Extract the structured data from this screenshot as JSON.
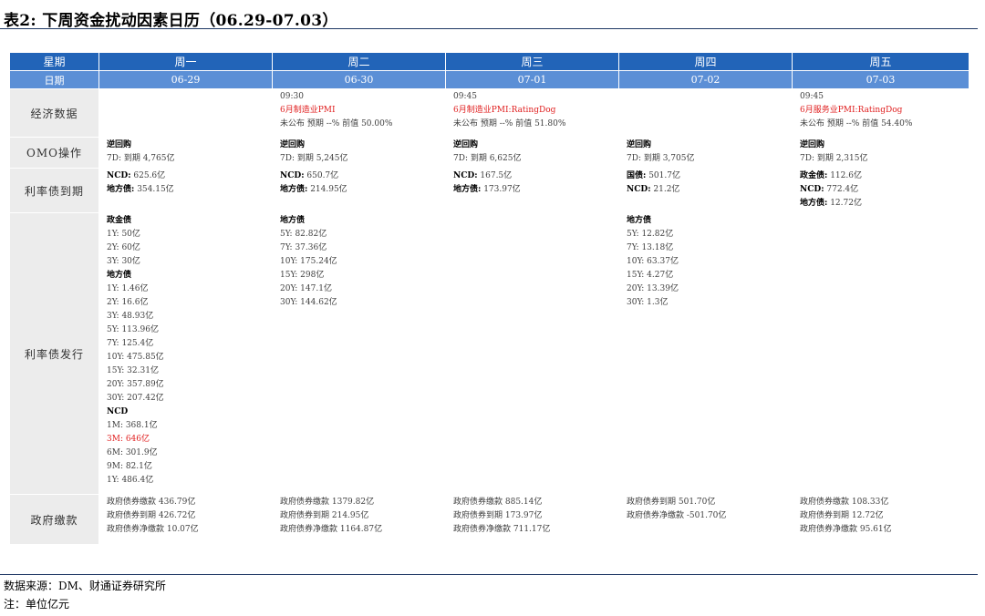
{
  "title": "表2: 下周资金扰动因素日历（06.29-07.03）",
  "header": {
    "corner_day": "星期",
    "corner_date": "日期",
    "days": [
      {
        "day": "周一",
        "date": "06-29"
      },
      {
        "day": "周二",
        "date": "06-30"
      },
      {
        "day": "周三",
        "date": "07-01"
      },
      {
        "day": "周四",
        "date": "07-02"
      },
      {
        "day": "周五",
        "date": "07-03"
      }
    ]
  },
  "rows": {
    "econ": {
      "label": "经济数据",
      "cells": [
        [],
        [
          {
            "t": "09:30"
          },
          {
            "t": "6月制造业PMI",
            "red": true
          },
          {
            "t": "未公布 预期 --% 前值 50.00%"
          }
        ],
        [
          {
            "t": "09:45"
          },
          {
            "t": "6月制造业PMI:RatingDog",
            "red": true
          },
          {
            "t": "未公布 预期 --% 前值 51.80%"
          }
        ],
        [],
        [
          {
            "t": "09:45"
          },
          {
            "t": "6月服务业PMI:RatingDog",
            "red": true
          },
          {
            "t": "未公布 预期 --% 前值 54.40%"
          }
        ]
      ]
    },
    "omo": {
      "label": "OMO操作",
      "cells": [
        [
          {
            "k": "逆回购",
            "v": ""
          },
          {
            "t": "7D: 到期 4,765亿"
          }
        ],
        [
          {
            "k": "逆回购",
            "v": ""
          },
          {
            "t": "7D: 到期 5,245亿"
          }
        ],
        [
          {
            "k": "逆回购",
            "v": ""
          },
          {
            "t": "7D: 到期 6,625亿"
          }
        ],
        [
          {
            "k": "逆回购",
            "v": ""
          },
          {
            "t": "7D: 到期 3,705亿"
          }
        ],
        [
          {
            "k": "逆回购",
            "v": ""
          },
          {
            "t": "7D: 到期 2,315亿"
          }
        ]
      ]
    },
    "mature": {
      "label": "利率债到期",
      "cells": [
        [
          {
            "k": "NCD:",
            "v": " 625.6亿"
          },
          {
            "k": "地方债:",
            "v": " 354.15亿"
          }
        ],
        [
          {
            "k": "NCD:",
            "v": " 650.7亿"
          },
          {
            "k": "地方债:",
            "v": " 214.95亿"
          }
        ],
        [
          {
            "k": "NCD:",
            "v": " 167.5亿"
          },
          {
            "k": "地方债:",
            "v": " 173.97亿"
          }
        ],
        [
          {
            "k": "国债:",
            "v": " 501.7亿"
          },
          {
            "k": "NCD:",
            "v": " 21.2亿"
          }
        ],
        [
          {
            "k": "政金债:",
            "v": " 112.6亿"
          },
          {
            "k": "NCD:",
            "v": " 772.4亿"
          },
          {
            "k": "地方债:",
            "v": " 12.72亿"
          }
        ]
      ]
    },
    "issue": {
      "label": "利率债发行",
      "cells": [
        [
          {
            "k": "政金债",
            "v": ""
          },
          {
            "t": "1Y: 50亿"
          },
          {
            "t": "2Y: 60亿"
          },
          {
            "t": "3Y: 30亿"
          },
          {
            "k": "地方债",
            "v": ""
          },
          {
            "t": "1Y: 1.46亿"
          },
          {
            "t": "2Y: 16.6亿"
          },
          {
            "t": "3Y: 48.93亿"
          },
          {
            "t": "5Y: 113.96亿"
          },
          {
            "t": "7Y: 125.4亿"
          },
          {
            "t": "10Y: 475.85亿"
          },
          {
            "t": "15Y: 32.31亿"
          },
          {
            "t": "20Y: 357.89亿"
          },
          {
            "t": "30Y: 207.42亿"
          },
          {
            "k": "NCD",
            "v": ""
          },
          {
            "t": "1M: 368.1亿"
          },
          {
            "t": "3M: 646亿",
            "red": true
          },
          {
            "t": "6M: 301.9亿"
          },
          {
            "t": "9M: 82.1亿"
          },
          {
            "t": "1Y: 486.4亿"
          }
        ],
        [
          {
            "k": "地方债",
            "v": ""
          },
          {
            "t": "5Y: 82.82亿"
          },
          {
            "t": "7Y: 37.36亿"
          },
          {
            "t": "10Y: 175.24亿"
          },
          {
            "t": "15Y: 298亿"
          },
          {
            "t": "20Y: 147.1亿"
          },
          {
            "t": "30Y: 144.62亿"
          }
        ],
        [],
        [
          {
            "k": "地方债",
            "v": ""
          },
          {
            "t": "5Y: 12.82亿"
          },
          {
            "t": "7Y: 13.18亿"
          },
          {
            "t": "10Y: 63.37亿"
          },
          {
            "t": "15Y: 4.27亿"
          },
          {
            "t": "20Y: 13.39亿"
          },
          {
            "t": "30Y: 1.3亿"
          }
        ],
        []
      ]
    },
    "fiscal": {
      "label": "政府缴款",
      "cells": [
        [
          {
            "t": "政府债券缴款 436.79亿"
          },
          {
            "t": "政府债券到期 426.72亿"
          },
          {
            "t": "政府债券净缴款 10.07亿"
          }
        ],
        [
          {
            "t": "政府债券缴款 1379.82亿"
          },
          {
            "t": "政府债券到期 214.95亿"
          },
          {
            "t": "政府债券净缴款 1164.87亿"
          }
        ],
        [
          {
            "t": "政府债券缴款 885.14亿"
          },
          {
            "t": "政府债券到期 173.97亿"
          },
          {
            "t": "政府债券净缴款 711.17亿"
          }
        ],
        [
          {
            "t": "政府债券到期 501.70亿"
          },
          {
            "t": "政府债券净缴款 -501.70亿"
          }
        ],
        [
          {
            "t": "政府债券缴款 108.33亿"
          },
          {
            "t": "政府债券到期 12.72亿"
          },
          {
            "t": "政府债券净缴款 95.61亿"
          }
        ]
      ]
    }
  },
  "footer": {
    "source": "数据来源：DM、财通证券研究所",
    "note": "注：单位亿元"
  },
  "colors": {
    "header_dark": "#2264b8",
    "header_light": "#5b8fd6",
    "highlight": "#e02020",
    "row_label_bg": "#ececec"
  }
}
